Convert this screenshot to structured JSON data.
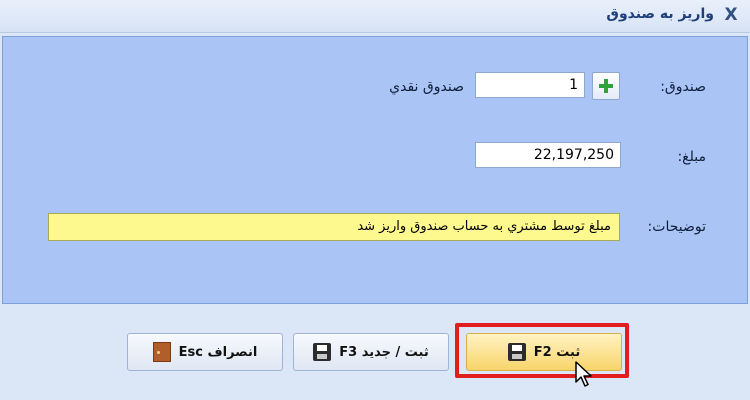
{
  "window": {
    "title": "واریز به صندوق",
    "close_label": "X"
  },
  "form": {
    "fund_label": "صندوق:",
    "fund_code": "1",
    "fund_name": "صندوق نقدي",
    "amount_label": "مبلغ:",
    "amount_value": "22,197,250",
    "description_label": "توضیحات:",
    "description_value": "مبلغ توسط مشتري به حساب صندوق واريز شد",
    "add_icon": "plus-icon"
  },
  "buttons": {
    "save_label": "ثبت F2",
    "save_new_label": "ثبت / جدید F3",
    "cancel_label": "انصراف Esc",
    "save_icon": "floppy-icon",
    "cancel_icon": "door-icon"
  },
  "colors": {
    "panel": "#a9c4f5",
    "description_bg": "#fdf98e",
    "highlight": "#e21d1d",
    "save_button": "#f8d46a"
  }
}
